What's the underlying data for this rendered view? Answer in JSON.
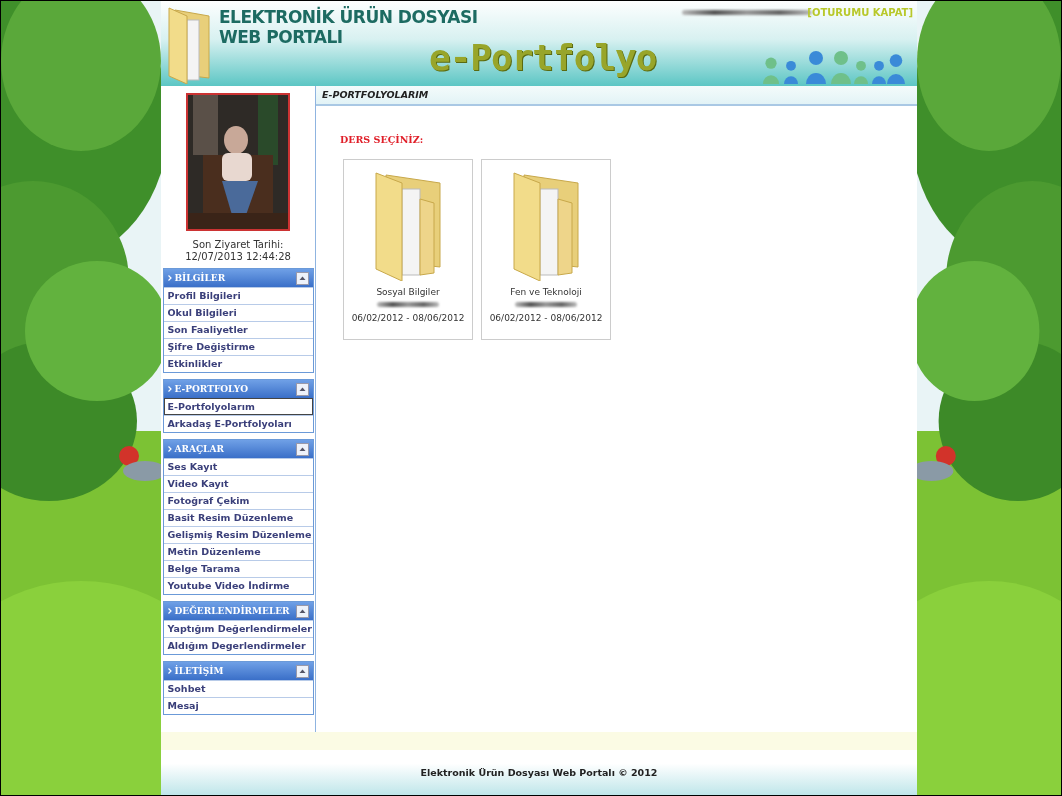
{
  "header": {
    "title_line1": "ELEKTRONİK ÜRÜN DOSYASI",
    "title_line2": "WEB PORTALI",
    "brand": "e-Portfolyo",
    "logout": "[OTURUMU KAPAT]"
  },
  "profile": {
    "last_visit_label": "Son Ziyaret Tarihi:",
    "last_visit": "12/07/2013 12:44:28"
  },
  "sidebar": {
    "sections": [
      {
        "title": "BİLGİLER",
        "expanded": true,
        "items": [
          {
            "label": "Profil Bilgileri",
            "selected": false
          },
          {
            "label": "Okul Bilgileri",
            "selected": false
          },
          {
            "label": "Son Faaliyetler",
            "selected": false
          },
          {
            "label": "Şifre Değiştirme",
            "selected": false
          },
          {
            "label": "Etkinlikler",
            "selected": false
          }
        ]
      },
      {
        "title": "E-PORTFOLYO",
        "expanded": true,
        "items": [
          {
            "label": "E-Portfolyolarım",
            "selected": true
          },
          {
            "label": "Arkadaş E-Portfolyoları",
            "selected": false
          }
        ]
      },
      {
        "title": "ARAÇLAR",
        "expanded": true,
        "items": [
          {
            "label": "Ses Kayıt",
            "selected": false
          },
          {
            "label": "Video Kayıt",
            "selected": false
          },
          {
            "label": "Fotoğraf Çekim",
            "selected": false
          },
          {
            "label": "Basit Resim Düzenleme",
            "selected": false
          },
          {
            "label": "Gelişmiş Resim Düzenleme",
            "selected": false
          },
          {
            "label": "Metin Düzenleme",
            "selected": false
          },
          {
            "label": "Belge Tarama",
            "selected": false
          },
          {
            "label": "Youtube Video İndirme",
            "selected": false
          }
        ]
      },
      {
        "title": "DEĞERLENDİRMELER",
        "expanded": true,
        "items": [
          {
            "label": "Yaptığım Değerlendirmeler",
            "selected": false
          },
          {
            "label": "Aldığım Degerlendirmeler",
            "selected": false
          }
        ]
      },
      {
        "title": "İLETİŞİM",
        "expanded": true,
        "items": [
          {
            "label": "Sohbet",
            "selected": false
          },
          {
            "label": "Mesaj",
            "selected": false
          }
        ]
      }
    ]
  },
  "main": {
    "breadcrumb": "E-PORTFOLYOLARIM",
    "prompt": "DERS SEÇİNİZ:",
    "courses": [
      {
        "name": "Sosyal Bilgiler",
        "dates": "06/02/2012 - 08/06/2012"
      },
      {
        "name": "Fen ve Teknoloji",
        "dates": "06/02/2012 - 08/06/2012"
      }
    ]
  },
  "footer": {
    "text": "Elektronik Ürün Dosyası Web Portalı © 2012"
  }
}
